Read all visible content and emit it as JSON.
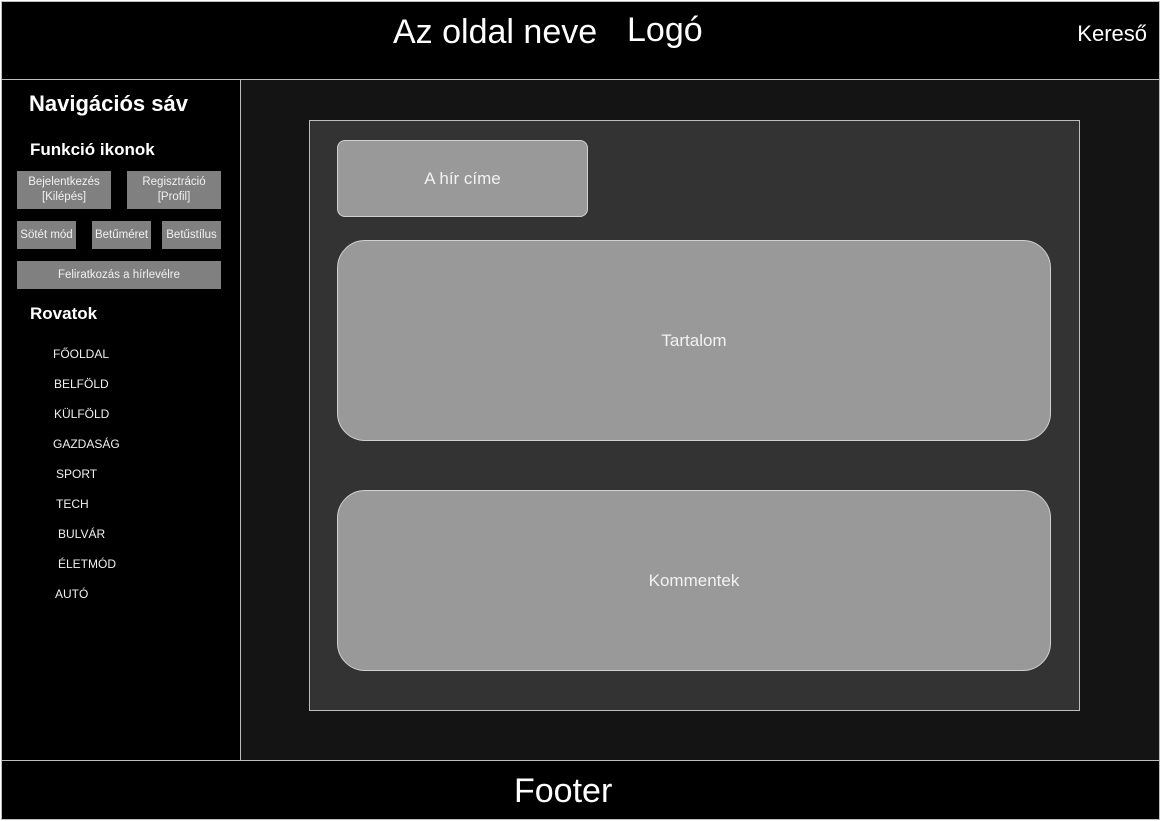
{
  "header": {
    "site_name": "Az oldal neve",
    "logo": "Logó",
    "search": "Kereső"
  },
  "sidebar": {
    "nav_title": "Navigációs sáv",
    "functions_title": "Funkció ikonok",
    "buttons": {
      "login": "Bejelentkezés\n[Kilépés]",
      "register": "Regisztráció\n[Profil]",
      "dark_mode": "Sötét mód",
      "font_size": "Betűméret",
      "font_style": "Betűstílus",
      "newsletter": "Feliratkozás a hírlevélre"
    },
    "sections_title": "Rovatok",
    "sections": [
      "FŐOLDAL",
      "BELFÖLD",
      "KÜLFÖLD",
      "GAZDASÁG",
      "SPORT",
      "TECH",
      "BULVÁR",
      "ÉLETMÓD",
      "AUTÓ"
    ]
  },
  "article": {
    "title": "A hír címe",
    "content": "Tartalom",
    "comments": "Kommentek"
  },
  "footer": {
    "text": "Footer"
  },
  "colors": {
    "background_dark": "#000000",
    "main_bg": "#141414",
    "article_bg": "#333333",
    "panel_bg": "#999999",
    "button_bg": "#808080",
    "border": "#bdbdbd"
  }
}
